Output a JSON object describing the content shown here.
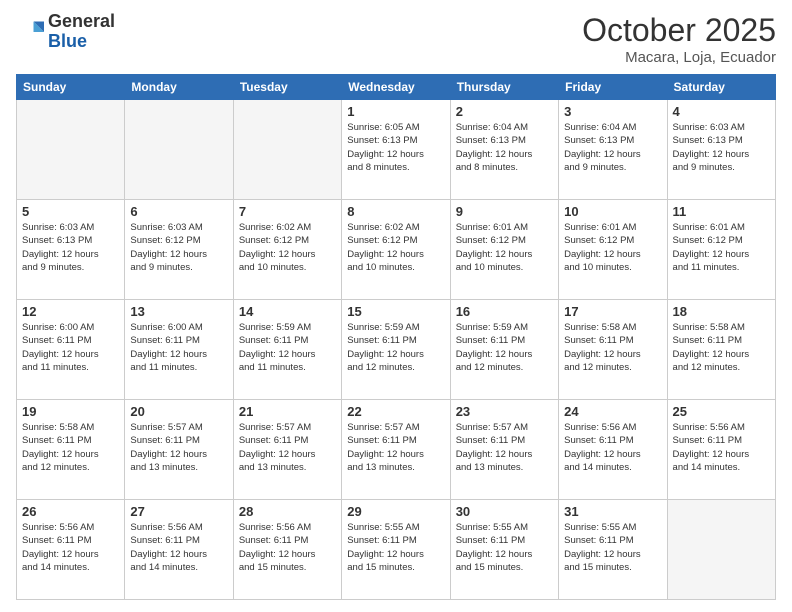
{
  "header": {
    "logo_general": "General",
    "logo_blue": "Blue",
    "month_year": "October 2025",
    "location": "Macara, Loja, Ecuador"
  },
  "weekdays": [
    "Sunday",
    "Monday",
    "Tuesday",
    "Wednesday",
    "Thursday",
    "Friday",
    "Saturday"
  ],
  "weeks": [
    [
      {
        "day": "",
        "info": ""
      },
      {
        "day": "",
        "info": ""
      },
      {
        "day": "",
        "info": ""
      },
      {
        "day": "1",
        "info": "Sunrise: 6:05 AM\nSunset: 6:13 PM\nDaylight: 12 hours\nand 8 minutes."
      },
      {
        "day": "2",
        "info": "Sunrise: 6:04 AM\nSunset: 6:13 PM\nDaylight: 12 hours\nand 8 minutes."
      },
      {
        "day": "3",
        "info": "Sunrise: 6:04 AM\nSunset: 6:13 PM\nDaylight: 12 hours\nand 9 minutes."
      },
      {
        "day": "4",
        "info": "Sunrise: 6:03 AM\nSunset: 6:13 PM\nDaylight: 12 hours\nand 9 minutes."
      }
    ],
    [
      {
        "day": "5",
        "info": "Sunrise: 6:03 AM\nSunset: 6:13 PM\nDaylight: 12 hours\nand 9 minutes."
      },
      {
        "day": "6",
        "info": "Sunrise: 6:03 AM\nSunset: 6:12 PM\nDaylight: 12 hours\nand 9 minutes."
      },
      {
        "day": "7",
        "info": "Sunrise: 6:02 AM\nSunset: 6:12 PM\nDaylight: 12 hours\nand 10 minutes."
      },
      {
        "day": "8",
        "info": "Sunrise: 6:02 AM\nSunset: 6:12 PM\nDaylight: 12 hours\nand 10 minutes."
      },
      {
        "day": "9",
        "info": "Sunrise: 6:01 AM\nSunset: 6:12 PM\nDaylight: 12 hours\nand 10 minutes."
      },
      {
        "day": "10",
        "info": "Sunrise: 6:01 AM\nSunset: 6:12 PM\nDaylight: 12 hours\nand 10 minutes."
      },
      {
        "day": "11",
        "info": "Sunrise: 6:01 AM\nSunset: 6:12 PM\nDaylight: 12 hours\nand 11 minutes."
      }
    ],
    [
      {
        "day": "12",
        "info": "Sunrise: 6:00 AM\nSunset: 6:11 PM\nDaylight: 12 hours\nand 11 minutes."
      },
      {
        "day": "13",
        "info": "Sunrise: 6:00 AM\nSunset: 6:11 PM\nDaylight: 12 hours\nand 11 minutes."
      },
      {
        "day": "14",
        "info": "Sunrise: 5:59 AM\nSunset: 6:11 PM\nDaylight: 12 hours\nand 11 minutes."
      },
      {
        "day": "15",
        "info": "Sunrise: 5:59 AM\nSunset: 6:11 PM\nDaylight: 12 hours\nand 12 minutes."
      },
      {
        "day": "16",
        "info": "Sunrise: 5:59 AM\nSunset: 6:11 PM\nDaylight: 12 hours\nand 12 minutes."
      },
      {
        "day": "17",
        "info": "Sunrise: 5:58 AM\nSunset: 6:11 PM\nDaylight: 12 hours\nand 12 minutes."
      },
      {
        "day": "18",
        "info": "Sunrise: 5:58 AM\nSunset: 6:11 PM\nDaylight: 12 hours\nand 12 minutes."
      }
    ],
    [
      {
        "day": "19",
        "info": "Sunrise: 5:58 AM\nSunset: 6:11 PM\nDaylight: 12 hours\nand 12 minutes."
      },
      {
        "day": "20",
        "info": "Sunrise: 5:57 AM\nSunset: 6:11 PM\nDaylight: 12 hours\nand 13 minutes."
      },
      {
        "day": "21",
        "info": "Sunrise: 5:57 AM\nSunset: 6:11 PM\nDaylight: 12 hours\nand 13 minutes."
      },
      {
        "day": "22",
        "info": "Sunrise: 5:57 AM\nSunset: 6:11 PM\nDaylight: 12 hours\nand 13 minutes."
      },
      {
        "day": "23",
        "info": "Sunrise: 5:57 AM\nSunset: 6:11 PM\nDaylight: 12 hours\nand 13 minutes."
      },
      {
        "day": "24",
        "info": "Sunrise: 5:56 AM\nSunset: 6:11 PM\nDaylight: 12 hours\nand 14 minutes."
      },
      {
        "day": "25",
        "info": "Sunrise: 5:56 AM\nSunset: 6:11 PM\nDaylight: 12 hours\nand 14 minutes."
      }
    ],
    [
      {
        "day": "26",
        "info": "Sunrise: 5:56 AM\nSunset: 6:11 PM\nDaylight: 12 hours\nand 14 minutes."
      },
      {
        "day": "27",
        "info": "Sunrise: 5:56 AM\nSunset: 6:11 PM\nDaylight: 12 hours\nand 14 minutes."
      },
      {
        "day": "28",
        "info": "Sunrise: 5:56 AM\nSunset: 6:11 PM\nDaylight: 12 hours\nand 15 minutes."
      },
      {
        "day": "29",
        "info": "Sunrise: 5:55 AM\nSunset: 6:11 PM\nDaylight: 12 hours\nand 15 minutes."
      },
      {
        "day": "30",
        "info": "Sunrise: 5:55 AM\nSunset: 6:11 PM\nDaylight: 12 hours\nand 15 minutes."
      },
      {
        "day": "31",
        "info": "Sunrise: 5:55 AM\nSunset: 6:11 PM\nDaylight: 12 hours\nand 15 minutes."
      },
      {
        "day": "",
        "info": ""
      }
    ]
  ]
}
